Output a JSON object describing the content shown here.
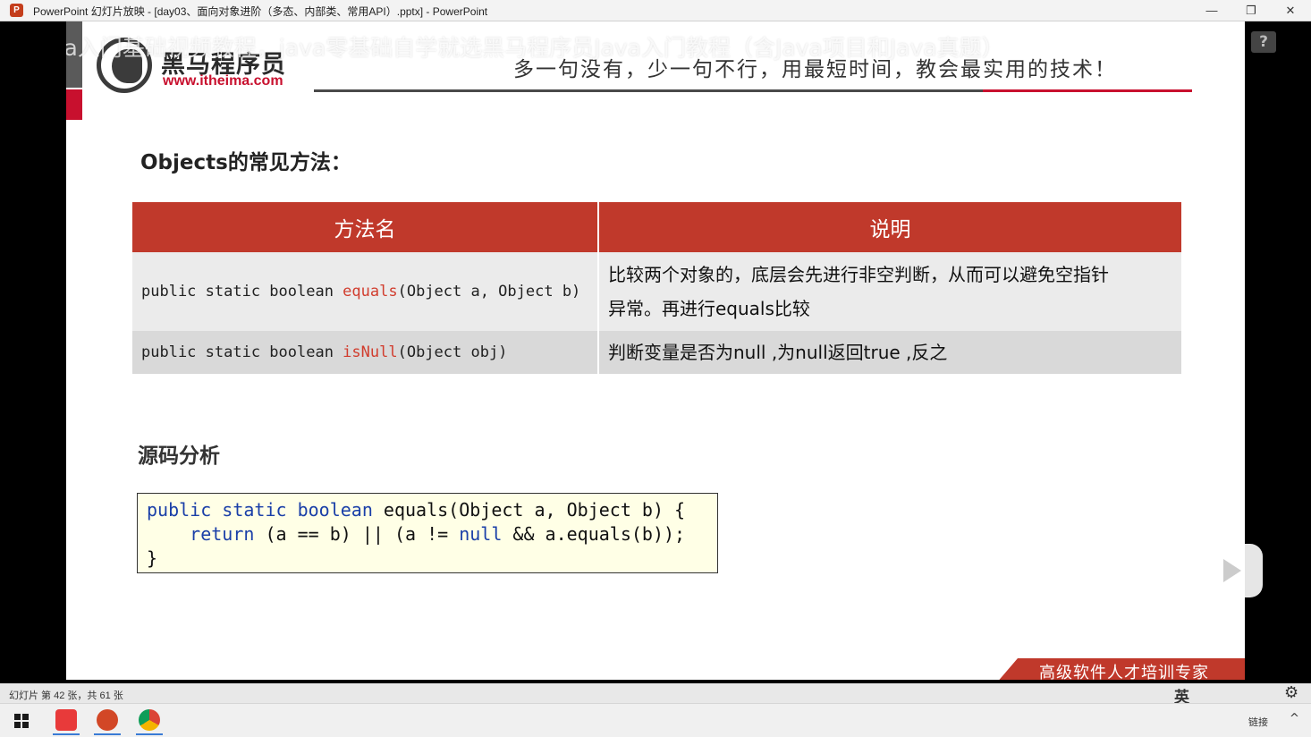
{
  "window": {
    "app_icon": "P",
    "title": "PowerPoint 幻灯片放映 - [day03、面向对象进阶（多态、内部类、常用API）.pptx] - PowerPoint",
    "minimize": "—",
    "restore": "❐",
    "close": "✕"
  },
  "overlay": {
    "watermark": "Java入门基础视频教程，java零基础自学就选黑马程序员Java入门教程（含Java项目和Java真题）",
    "help": "?"
  },
  "slide": {
    "logo_cn": "黑马程序员",
    "logo_url": "www.itheima.com",
    "slogan": "多一句没有，少一句不行，用最短时间，教会最实用的技术！",
    "section_title": "Objects的常见方法：",
    "table": {
      "headers": [
        "方法名",
        "说明"
      ],
      "rows": [
        {
          "prefix": "public static boolean ",
          "method": "equals",
          "suffix": "(Object a, Object b)",
          "desc_line1": "比较两个对象的，底层会先进行非空判断，从而可以避免空指针",
          "desc_line2": "异常。再进行equals比较"
        },
        {
          "prefix": "public static boolean ",
          "method": "isNull",
          "suffix": "(Object obj)",
          "desc_line1": "判断变量是否为null ,为null返回true ,反之",
          "desc_line2": ""
        }
      ]
    },
    "section2_title": "源码分析",
    "code": {
      "line1_kw": "public static boolean",
      "line1_rest": " equals(Object a, Object b) {",
      "line2_indent": "    ",
      "line2_kw": "return",
      "line2_mid": " (a == b) || (a != ",
      "line2_kw2": "null",
      "line2_end": " && a.equals(b));",
      "line3": "}"
    },
    "footer_tag": "高级软件人才培训专家"
  },
  "statusbar": {
    "slide_info": "幻灯片 第 42 张，共 61 张",
    "ime": "英",
    "settings_icon": "⚙"
  },
  "taskbar": {
    "tray_text": "链接",
    "tray_arrow": "^"
  },
  "colors": {
    "accent_red": "#c0392b",
    "brand_red": "#c8102e",
    "keyword_blue": "#1a3fa8"
  }
}
